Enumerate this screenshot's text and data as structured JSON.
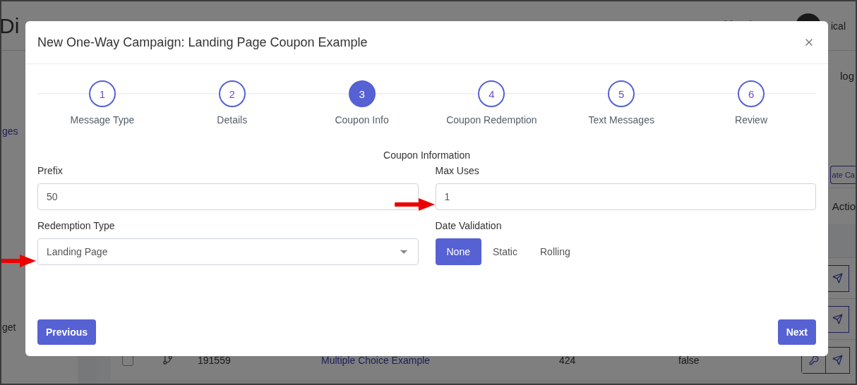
{
  "background": {
    "header_title": "Di",
    "user_name": "ical",
    "sidebar_items": [
      "ges",
      "get"
    ],
    "tab_label": "log",
    "create_button": "ate Ca",
    "actions_header": "Actio",
    "row": {
      "checked": false,
      "id": "191559",
      "name": "Multiple Choice Example",
      "count": "424",
      "flag": "false"
    }
  },
  "modal": {
    "title": "New One-Way Campaign: Landing Page Coupon Example",
    "steps": [
      {
        "number": "1",
        "label": "Message Type",
        "selected": false
      },
      {
        "number": "2",
        "label": "Details",
        "selected": false
      },
      {
        "number": "3",
        "label": "Coupon Info",
        "selected": true
      },
      {
        "number": "4",
        "label": "Coupon Redemption",
        "selected": false
      },
      {
        "number": "5",
        "label": "Text Messages",
        "selected": false
      },
      {
        "number": "6",
        "label": "Review",
        "selected": false
      }
    ],
    "section_title": "Coupon Information",
    "prefix": {
      "label": "Prefix",
      "value": "50"
    },
    "max_uses": {
      "label": "Max Uses",
      "value": "1"
    },
    "redemption_type": {
      "label": "Redemption Type",
      "value": "Landing Page"
    },
    "date_validation": {
      "label": "Date Validation",
      "options": [
        {
          "label": "None",
          "selected": true
        },
        {
          "label": "Static",
          "selected": false
        },
        {
          "label": "Rolling",
          "selected": false
        }
      ]
    },
    "previous_button": "Previous",
    "next_button": "Next"
  }
}
